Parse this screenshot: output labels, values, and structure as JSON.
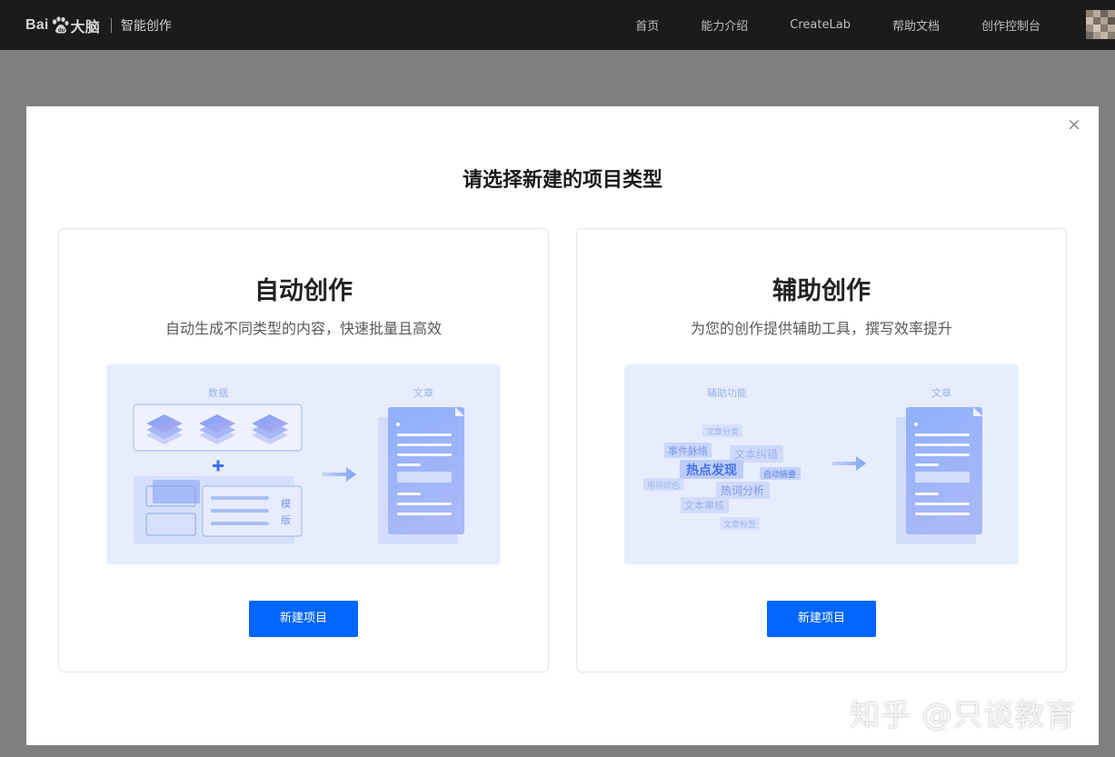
{
  "header": {
    "brand_left": "Bai",
    "brand_right": "大脑",
    "product": "智能创作",
    "nav": [
      "首页",
      "能力介绍",
      "CreateLab",
      "帮助文档",
      "创作控制台"
    ],
    "icons": {
      "logo": "baidu-paw-icon",
      "avatar": "user-avatar"
    }
  },
  "modal": {
    "close": "×",
    "title": "请选择新建的项目类型",
    "cards": [
      {
        "title": "自动创作",
        "desc": "自动生成不同类型的内容，快速批量且高效",
        "illus": {
          "label_data": "数据",
          "label_article": "文章",
          "template_chars": [
            "模",
            "版"
          ]
        },
        "button": "新建项目"
      },
      {
        "title": "辅助创作",
        "desc": "为您的创作提供辅助工具，撰写效率提升",
        "illus": {
          "label_tools": "辅助功能",
          "label_article": "文章",
          "tags": [
            "文章分类",
            "事件脉络",
            "文本纠错",
            "热点发现",
            "自动摘要",
            "用词润色",
            "热词分析",
            "文本审核",
            "文章标签"
          ]
        },
        "button": "新建项目"
      }
    ]
  },
  "watermark": "知乎 @只谈教育",
  "colors": {
    "primary": "#0066ff",
    "topbar": "#1b1b1b",
    "overlay": "#7f7f7f",
    "illus_bg": "#e7edfc"
  }
}
